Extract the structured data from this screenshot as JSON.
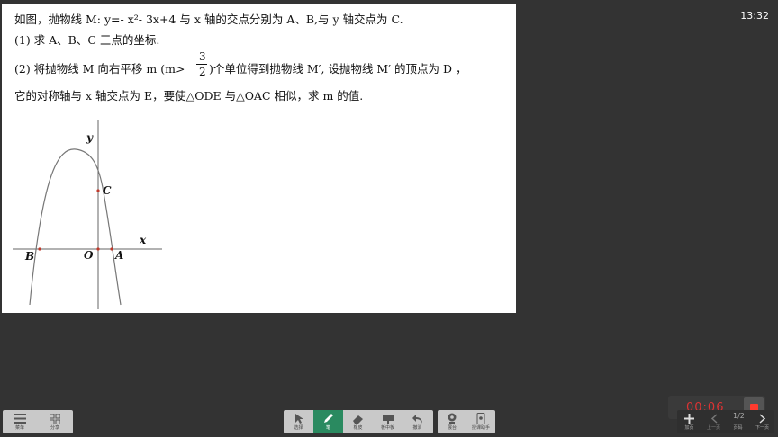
{
  "clock": "13:32",
  "question": {
    "line1": "如图，抛物线 M:    y=- x²- 3x+4 与 x 轴的交点分别为 A、B,与 y 轴交点为 C.",
    "line2": "(1)  求 A、B、C 三点的坐标.",
    "line3a": "(2)  将抛物线 M 向右平移 m    (m>",
    "line3b": ")个单位得到抛物线 M′,    设抛物线 M′    的顶点为 D ，",
    "frac_num": "3",
    "frac_den": "2",
    "line4": "它的对称轴与 x 轴交点为 E，要使△ODE 与△OAC 相似，求 m 的值."
  },
  "graph": {
    "y_label": "y",
    "x_label": "x",
    "point_labels": {
      "B": "B",
      "O": "O",
      "A": "A",
      "C": "C"
    },
    "colors": {
      "curve": "#777777",
      "axis": "#666666",
      "point": "#c0392b"
    }
  },
  "toolbar_left": {
    "menu_label": "菜单",
    "share_label": "分享"
  },
  "toolbar_center": {
    "select_label": "选择",
    "pen_label": "笔",
    "eraser_label": "橡皮",
    "board_label": "板中板",
    "undo_label": "撤消"
  },
  "toolbar_tools": {
    "camera_label": "展台",
    "assistant_label": "授课助手"
  },
  "toolbar_right": {
    "add_label": "加页",
    "prev_label": "上一页",
    "page_label": "页码",
    "next_label": "下一页"
  },
  "recording": {
    "timer": "00:06",
    "page_indicator": "1/2"
  },
  "accent": "#2a8a60"
}
